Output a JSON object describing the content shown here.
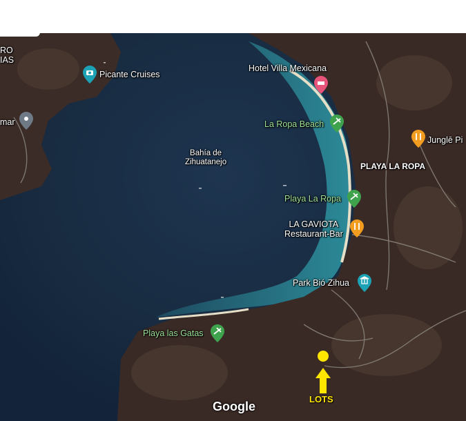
{
  "map": {
    "bay_label": [
      "Bahía de",
      "Zihuatanejo"
    ],
    "neighborhood_label": "PLAYA LA ROPA",
    "edge_label_top": "RO",
    "edge_label_bottom": "IAS",
    "places": {
      "picante_cruises": "Picante Cruises",
      "hotel_villa_mexicana": "Hotel Villa Mexicana",
      "la_ropa_beach": "La Ropa Beach",
      "jungle": "Junglē Pi",
      "playa_la_ropa": "Playa La Ropa",
      "la_gaviota": [
        "LA GAVIOTA",
        "Restaurant-Bar"
      ],
      "park_bio_zihua": "Park Bió Zihua",
      "playa_las_gatas": "Playa las Gatas",
      "mar": "mar"
    },
    "annotation": {
      "label": "LOTS",
      "color": "#ffe600"
    },
    "attribution": "Google",
    "colors": {
      "water_deep": "#1a2c42",
      "water_shallow": "#2f8e9c",
      "land": "#3a2a26",
      "beach": "#e8e1c8",
      "pin_green": "#3fa34d",
      "pin_orange": "#f29d1f",
      "pin_teal": "#1da1b5",
      "pin_pink": "#e8537a",
      "pin_gray": "#6e7a86"
    }
  }
}
